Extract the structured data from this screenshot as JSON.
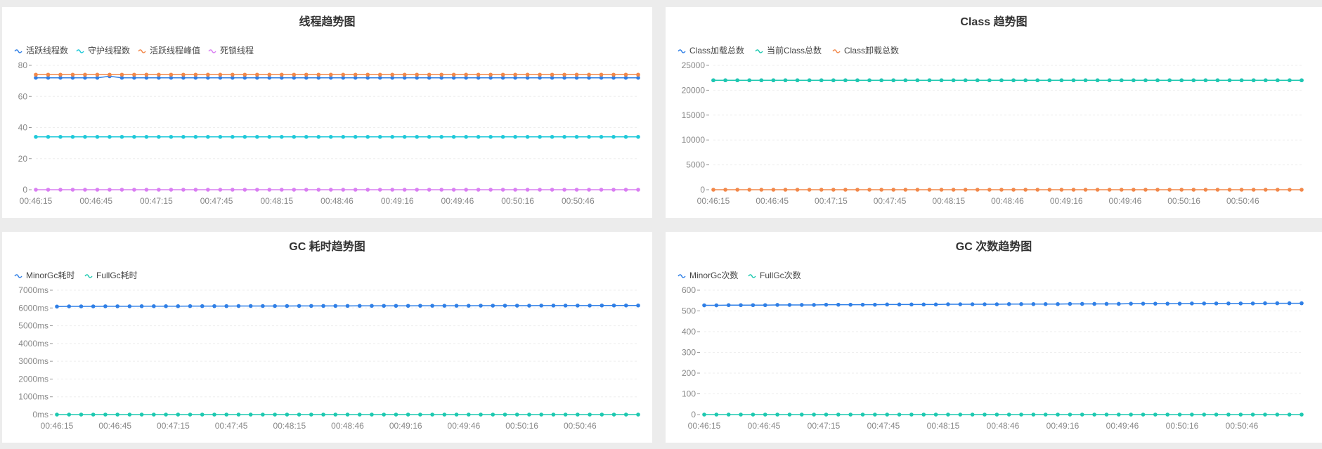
{
  "chart_data": [
    {
      "type": "line",
      "title": "线程趋势图",
      "x": [
        "00:46:15",
        "00:46:45",
        "00:47:15",
        "00:47:45",
        "00:48:15",
        "00:48:46",
        "00:49:16",
        "00:49:46",
        "00:50:16",
        "00:50:46"
      ],
      "ylim": [
        0,
        80
      ],
      "yticks": [
        0,
        20,
        40,
        60,
        80
      ],
      "ytick_labels": [
        "0",
        "20",
        "40",
        "60",
        "80"
      ],
      "grid": true,
      "legend": "top-left",
      "point_count": 50,
      "series": [
        {
          "name": "活跃线程数",
          "color": "#2f7fe6",
          "values": [
            72,
            72,
            72,
            72,
            72,
            72,
            73,
            72,
            72,
            72,
            72,
            72,
            72,
            72,
            72,
            72,
            72,
            72,
            72,
            72,
            72,
            72,
            72,
            72,
            72,
            72,
            72,
            72,
            72,
            72,
            72,
            72,
            72,
            72,
            72,
            72,
            72,
            72,
            72,
            72,
            72,
            72,
            72,
            72,
            72,
            72,
            72,
            72,
            72,
            72
          ]
        },
        {
          "name": "守护线程数",
          "color": "#1ec9d9",
          "values": [
            34,
            34,
            34,
            34,
            34,
            34,
            34,
            34,
            34,
            34,
            34,
            34,
            34,
            34,
            34,
            34,
            34,
            34,
            34,
            34,
            34,
            34,
            34,
            34,
            34,
            34,
            34,
            34,
            34,
            34,
            34,
            34,
            34,
            34,
            34,
            34,
            34,
            34,
            34,
            34,
            34,
            34,
            34,
            34,
            34,
            34,
            34,
            34,
            34,
            34
          ]
        },
        {
          "name": "活跃线程峰值",
          "color": "#f2884a",
          "values": [
            74,
            74,
            74,
            74,
            74,
            74,
            74,
            74,
            74,
            74,
            74,
            74,
            74,
            74,
            74,
            74,
            74,
            74,
            74,
            74,
            74,
            74,
            74,
            74,
            74,
            74,
            74,
            74,
            74,
            74,
            74,
            74,
            74,
            74,
            74,
            74,
            74,
            74,
            74,
            74,
            74,
            74,
            74,
            74,
            74,
            74,
            74,
            74,
            74,
            74
          ]
        },
        {
          "name": "死锁线程",
          "color": "#d97ef2",
          "values": [
            0,
            0,
            0,
            0,
            0,
            0,
            0,
            0,
            0,
            0,
            0,
            0,
            0,
            0,
            0,
            0,
            0,
            0,
            0,
            0,
            0,
            0,
            0,
            0,
            0,
            0,
            0,
            0,
            0,
            0,
            0,
            0,
            0,
            0,
            0,
            0,
            0,
            0,
            0,
            0,
            0,
            0,
            0,
            0,
            0,
            0,
            0,
            0,
            0,
            0
          ]
        }
      ]
    },
    {
      "type": "line",
      "title": "Class 趋势图",
      "x": [
        "00:46:15",
        "00:46:45",
        "00:47:15",
        "00:47:45",
        "00:48:15",
        "00:48:46",
        "00:49:16",
        "00:49:46",
        "00:50:16",
        "00:50:46"
      ],
      "ylim": [
        0,
        25000
      ],
      "yticks": [
        0,
        5000,
        10000,
        15000,
        20000,
        25000
      ],
      "ytick_labels": [
        "0",
        "5000",
        "10000",
        "15000",
        "20000",
        "25000"
      ],
      "grid": true,
      "legend": "top-left",
      "point_count": 50,
      "series": [
        {
          "name": "Class加载总数",
          "color": "#2f7fe6",
          "values": [
            22000,
            22000,
            22000,
            22000,
            22000,
            22000,
            22000,
            22000,
            22000,
            22000,
            22000,
            22000,
            22000,
            22000,
            22000,
            22000,
            22000,
            22000,
            22000,
            22000,
            22000,
            22000,
            22000,
            22000,
            22000,
            22000,
            22000,
            22000,
            22000,
            22000,
            22000,
            22000,
            22000,
            22000,
            22000,
            22000,
            22000,
            22000,
            22000,
            22000,
            22000,
            22000,
            22000,
            22000,
            22000,
            22000,
            22000,
            22000,
            22000,
            22000
          ]
        },
        {
          "name": "当前Class总数",
          "color": "#1ec9b0",
          "values": [
            22000,
            22000,
            22000,
            22000,
            22000,
            22000,
            22000,
            22000,
            22000,
            22000,
            22000,
            22000,
            22000,
            22000,
            22000,
            22000,
            22000,
            22000,
            22000,
            22000,
            22000,
            22000,
            22000,
            22000,
            22000,
            22000,
            22000,
            22000,
            22000,
            22000,
            22000,
            22000,
            22000,
            22000,
            22000,
            22000,
            22000,
            22000,
            22000,
            22000,
            22000,
            22000,
            22000,
            22000,
            22000,
            22000,
            22000,
            22000,
            22000,
            22000
          ]
        },
        {
          "name": "Class卸载总数",
          "color": "#f2884a",
          "values": [
            0,
            0,
            0,
            0,
            0,
            0,
            0,
            0,
            0,
            0,
            0,
            0,
            0,
            0,
            0,
            0,
            0,
            0,
            0,
            0,
            0,
            0,
            0,
            0,
            0,
            0,
            0,
            0,
            0,
            0,
            0,
            0,
            0,
            0,
            0,
            0,
            0,
            0,
            0,
            0,
            0,
            0,
            0,
            0,
            0,
            0,
            0,
            0,
            0,
            0
          ]
        }
      ]
    },
    {
      "type": "line",
      "title": "GC 耗时趋势图",
      "x": [
        "00:46:15",
        "00:46:45",
        "00:47:15",
        "00:47:45",
        "00:48:15",
        "00:48:46",
        "00:49:16",
        "00:49:46",
        "00:50:16",
        "00:50:46"
      ],
      "ylim": [
        0,
        7000
      ],
      "yticks": [
        0,
        1000,
        2000,
        3000,
        4000,
        5000,
        6000,
        7000
      ],
      "ytick_labels": [
        "0ms",
        "1000ms",
        "2000ms",
        "3000ms",
        "4000ms",
        "5000ms",
        "6000ms",
        "7000ms"
      ],
      "grid": true,
      "legend": "top-left",
      "point_count": 49,
      "series": [
        {
          "name": "MinorGc耗时",
          "color": "#2f7fe6",
          "values": [
            6080,
            6090,
            6090,
            6090,
            6095,
            6095,
            6095,
            6100,
            6100,
            6100,
            6100,
            6105,
            6105,
            6105,
            6105,
            6110,
            6110,
            6110,
            6110,
            6110,
            6115,
            6115,
            6115,
            6115,
            6115,
            6120,
            6120,
            6120,
            6120,
            6120,
            6125,
            6125,
            6125,
            6125,
            6125,
            6130,
            6130,
            6130,
            6130,
            6130,
            6135,
            6135,
            6135,
            6135,
            6135,
            6140,
            6140,
            6140,
            6140
          ]
        },
        {
          "name": "FullGc耗时",
          "color": "#1ec9b0",
          "values": [
            0,
            0,
            0,
            0,
            0,
            0,
            0,
            0,
            0,
            0,
            0,
            0,
            0,
            0,
            0,
            0,
            0,
            0,
            0,
            0,
            0,
            0,
            0,
            0,
            0,
            0,
            0,
            0,
            0,
            0,
            0,
            0,
            0,
            0,
            0,
            0,
            0,
            0,
            0,
            0,
            0,
            0,
            0,
            0,
            0,
            0,
            0,
            0,
            0
          ]
        }
      ]
    },
    {
      "type": "line",
      "title": "GC 次数趋势图",
      "x": [
        "00:46:15",
        "00:46:45",
        "00:47:15",
        "00:47:45",
        "00:48:15",
        "00:48:46",
        "00:49:16",
        "00:49:46",
        "00:50:16",
        "00:50:46"
      ],
      "ylim": [
        0,
        600
      ],
      "yticks": [
        0,
        100,
        200,
        300,
        400,
        500,
        600
      ],
      "ytick_labels": [
        "0",
        "100",
        "200",
        "300",
        "400",
        "500",
        "600"
      ],
      "grid": true,
      "legend": "top-left",
      "point_count": 50,
      "series": [
        {
          "name": "MinorGc次数",
          "color": "#2f7fe6",
          "values": [
            527,
            527,
            528,
            528,
            528,
            528,
            529,
            529,
            529,
            529,
            530,
            530,
            530,
            530,
            530,
            531,
            531,
            531,
            531,
            531,
            532,
            532,
            532,
            532,
            532,
            533,
            533,
            533,
            533,
            533,
            534,
            534,
            534,
            534,
            534,
            535,
            535,
            535,
            535,
            535,
            536,
            536,
            536,
            536,
            536,
            536,
            537,
            537,
            537,
            537
          ]
        },
        {
          "name": "FullGc次数",
          "color": "#1ec9b0",
          "values": [
            0,
            0,
            0,
            0,
            0,
            0,
            0,
            0,
            0,
            0,
            0,
            0,
            0,
            0,
            0,
            0,
            0,
            0,
            0,
            0,
            0,
            0,
            0,
            0,
            0,
            0,
            0,
            0,
            0,
            0,
            0,
            0,
            0,
            0,
            0,
            0,
            0,
            0,
            0,
            0,
            0,
            0,
            0,
            0,
            0,
            0,
            0,
            0,
            0,
            0
          ]
        }
      ]
    }
  ]
}
